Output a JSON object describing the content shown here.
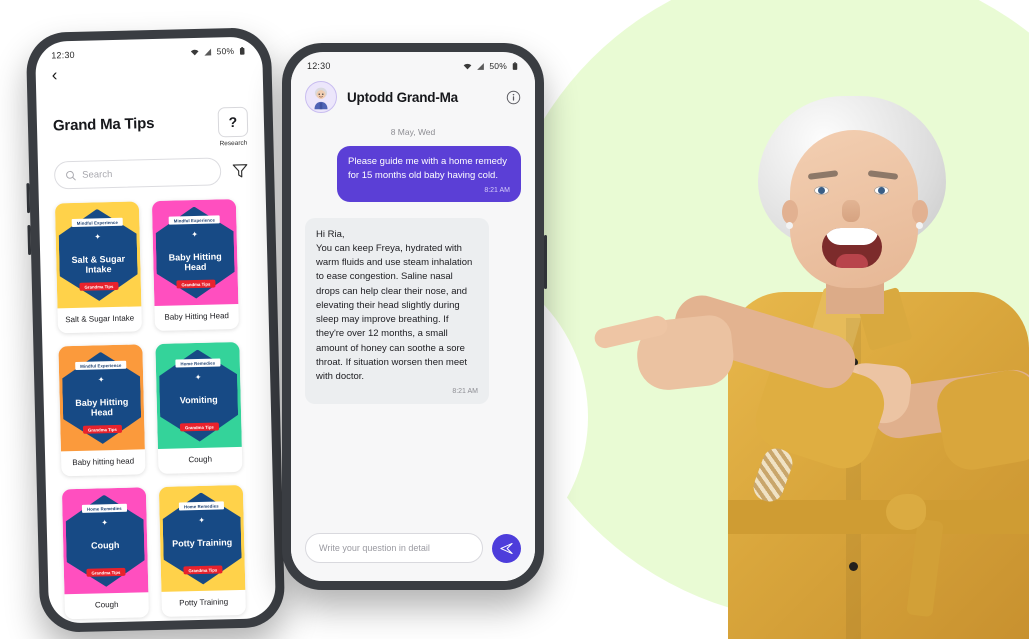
{
  "background": {
    "accent_circle_color": "#e9fbd4"
  },
  "left_phone": {
    "status_bar": {
      "time": "12:30",
      "wifi_icon": "wifi-icon",
      "signal_icon": "signal-icon",
      "battery_text": "50%",
      "battery_icon": "battery-icon"
    },
    "back_icon": "chevron-left-icon",
    "page_title": "Grand Ma Tips",
    "research": {
      "glyph": "?",
      "label": "Research"
    },
    "search": {
      "icon": "search-icon",
      "placeholder": "Search"
    },
    "filter_icon": "filter-funnel-icon",
    "cards": [
      {
        "label": "Salt & Sugar Intake",
        "art_title": "Salt & Sugar Intake",
        "ribbon": "Mindful Experience",
        "tag": "Grandma Tips",
        "bg_color": "#ffd24a",
        "badge_color": "#174a85"
      },
      {
        "label": "Baby Hitting Head",
        "art_title": "Baby Hitting Head",
        "ribbon": "Mindful Experience",
        "tag": "Grandma Tips",
        "bg_color": "#ff4fbf",
        "badge_color": "#174a85"
      },
      {
        "label": "Baby hitting head",
        "art_title": "Baby Hitting Head",
        "ribbon": "Mindful Experience",
        "tag": "Grandma Tips",
        "bg_color": "#fb9a3c",
        "badge_color": "#174a85"
      },
      {
        "label": "Cough",
        "art_title": "Vomiting",
        "ribbon": "Home Remedies",
        "tag": "Grandma Tips",
        "bg_color": "#34d39a",
        "badge_color": "#174a85"
      },
      {
        "label": "Cough",
        "art_title": "Cough",
        "ribbon": "Home Remedies",
        "tag": "Grandma Tips",
        "bg_color": "#ff4fbf",
        "badge_color": "#174a85"
      },
      {
        "label": "Potty Training",
        "art_title": "Potty Training",
        "ribbon": "Home Remedies",
        "tag": "Grandma Tips",
        "bg_color": "#ffd24a",
        "badge_color": "#174a85"
      }
    ]
  },
  "right_phone": {
    "status_bar": {
      "time": "12:30",
      "wifi_icon": "wifi-icon",
      "signal_icon": "signal-icon",
      "battery_text": "50%",
      "battery_icon": "battery-icon"
    },
    "header": {
      "avatar_icon": "grandma-avatar-icon",
      "contact_name": "Uptodd Grand-Ma",
      "info_icon": "info-icon"
    },
    "date_divider": "8 May, Wed",
    "messages": [
      {
        "direction": "outgoing",
        "text": "Please guide me with a home remedy for 15 months old baby having cold.",
        "time": "8:21 AM",
        "bubble_color": "#5b3fd6"
      },
      {
        "direction": "incoming",
        "text": "Hi Ria,\nYou can keep Freya, hydrated with warm fluids and use steam inhalation to ease congestion. Saline nasal drops can help clear their nose, and elevating their head slightly during sleep may improve breathing. If they're over 12 months, a small amount of honey can soothe a sore throat. If situation worsen then meet with doctor.",
        "time": "8:21 AM",
        "bubble_color": "#eceef0"
      }
    ],
    "composer": {
      "placeholder": "Write your question in detail",
      "send_icon": "send-paper-plane-icon",
      "send_button_color": "#4d3ddb"
    }
  },
  "photo": {
    "subject": "smiling-elderly-woman-pointing-left",
    "garment_color": "#d9a63c"
  }
}
